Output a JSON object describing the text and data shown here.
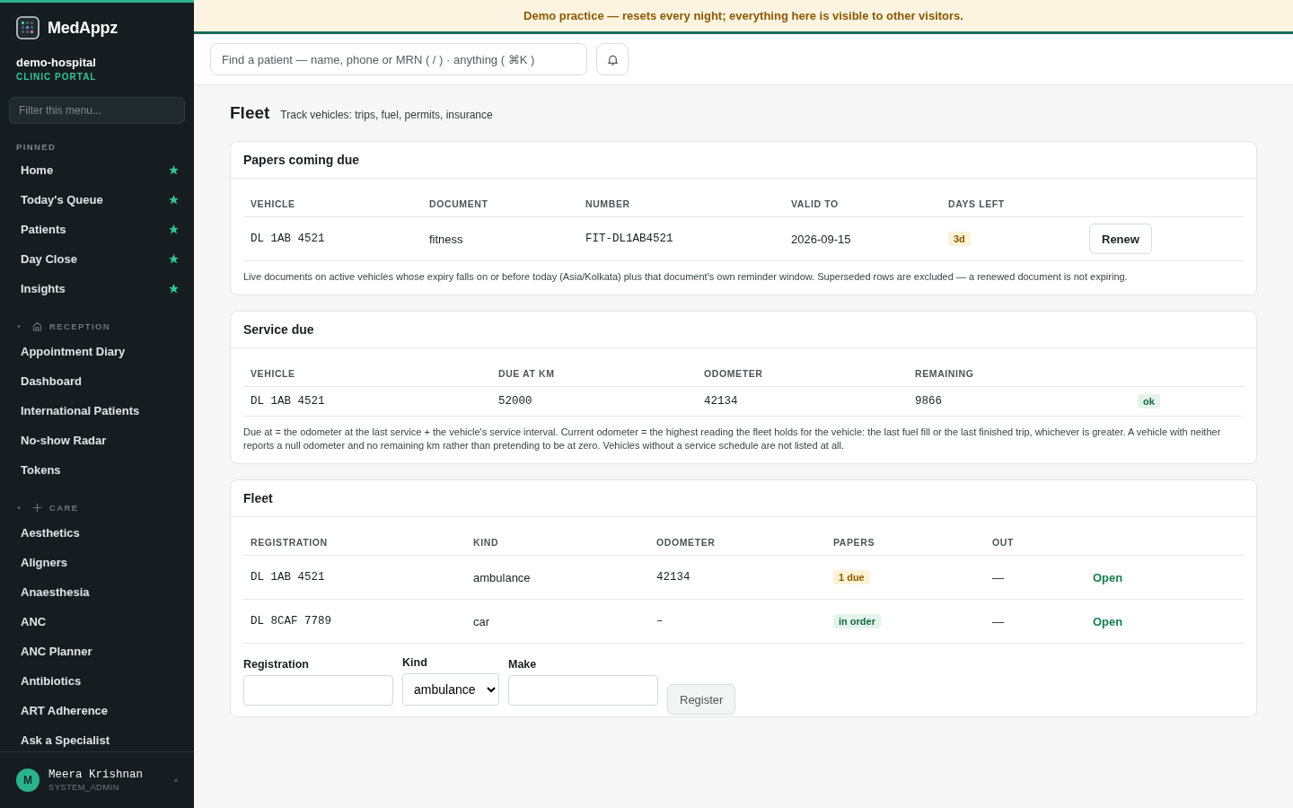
{
  "banner": {
    "text": "Demo practice — resets every night; everything here is visible to other visitors."
  },
  "sidebar": {
    "brand": "MedAppz",
    "org": "demo-hospital",
    "org_sub": "CLINIC PORTAL",
    "filter_placeholder": "Filter this menu...",
    "pinned_label": "PINNED",
    "pinned": [
      {
        "label": "Home"
      },
      {
        "label": "Today's Queue"
      },
      {
        "label": "Patients"
      },
      {
        "label": "Day Close"
      },
      {
        "label": "Insights"
      }
    ],
    "groups": [
      {
        "label": "RECEPTION",
        "kind": "house",
        "expanded": true,
        "items": [
          "Appointment Diary",
          "Dashboard",
          "International Patients",
          "No-show Radar",
          "Tokens"
        ]
      },
      {
        "label": "CARE",
        "kind": "plus",
        "expanded": true,
        "items": [
          "Aesthetics",
          "Aligners",
          "Anaesthesia",
          "ANC",
          "ANC Planner",
          "Antibiotics",
          "ART Adherence",
          "Ask a Specialist"
        ]
      }
    ],
    "user": {
      "initial": "M",
      "name": "Meera Krishnan",
      "role": "SYSTEM_ADMIN"
    }
  },
  "search": {
    "placeholder": "Find a patient — name, phone or MRN ( / ) · anything ( ⌘K )"
  },
  "page": {
    "title": "Fleet",
    "subtitle": "Track vehicles: trips, fuel, permits, insurance"
  },
  "papers": {
    "title": "Papers coming due",
    "columns": [
      "VEHICLE",
      "DOCUMENT",
      "NUMBER",
      "VALID TO",
      "DAYS LEFT"
    ],
    "rows": [
      {
        "vehicle": "DL 1AB 4521",
        "document": "fitness",
        "number": "FIT-DL1AB4521",
        "valid_to": "2026-09-15",
        "days_left": {
          "text": "3d",
          "kind": "warn"
        },
        "action": "Renew"
      }
    ],
    "note": "Live documents on active vehicles whose expiry falls on or before today (Asia/Kolkata) plus that document's own reminder window. Superseded rows are excluded — a renewed document is not expiring."
  },
  "service": {
    "title": "Service due",
    "columns": [
      "VEHICLE",
      "DUE AT KM",
      "ODOMETER",
      "REMAINING"
    ],
    "rows": [
      {
        "vehicle": "DL 1AB 4521",
        "due_at": "52000",
        "odometer": "42134",
        "remaining": "9866",
        "status": {
          "text": "ok",
          "kind": "ok"
        }
      }
    ],
    "note": "Due at = the odometer at the last service + the vehicle's service interval. Current odometer = the highest reading the fleet holds for the vehicle: the last fuel fill or the last finished trip, whichever is greater. A vehicle with neither reports a null odometer and no remaining km rather than pretending to be at zero. Vehicles without a service schedule are not listed at all."
  },
  "fleet": {
    "title": "Fleet",
    "columns": [
      "REGISTRATION",
      "KIND",
      "ODOMETER",
      "PAPERS",
      "OUT"
    ],
    "rows": [
      {
        "registration": "DL 1AB 4521",
        "kind": "ambulance",
        "odometer": "42134",
        "papers": {
          "text": "1 due",
          "kind": "warn"
        },
        "out": "—",
        "action": "Open"
      },
      {
        "registration": "DL 8CAF 7789",
        "kind": "car",
        "odometer": "–",
        "papers": {
          "text": "in order",
          "kind": "ok"
        },
        "out": "—",
        "action": "Open"
      }
    ],
    "form": [
      {
        "label": "Registration",
        "kind": "text"
      },
      {
        "label": "Kind",
        "kind": "select",
        "value": "ambulance"
      },
      {
        "label": "Make",
        "kind": "text"
      }
    ],
    "submit": "Register"
  }
}
